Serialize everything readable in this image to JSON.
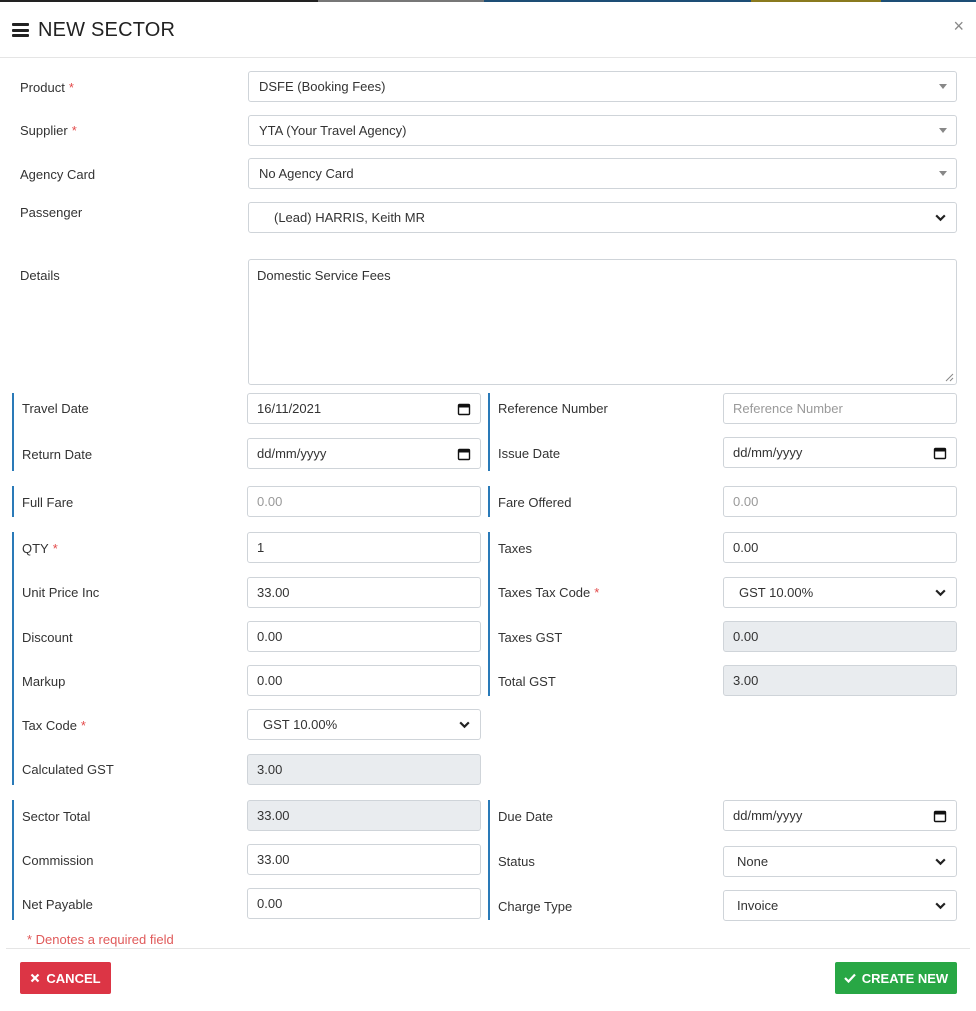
{
  "colors": {
    "accent_bar": "#2a7ab8",
    "danger": "#dc3545",
    "success": "#28a745",
    "required": "#e34a4a"
  },
  "header": {
    "title": "NEW SECTOR",
    "close_label": "×"
  },
  "required_marker": "*",
  "form": {
    "product": {
      "label": "Product",
      "value": "DSFE (Booking Fees)"
    },
    "supplier": {
      "label": "Supplier",
      "value": "YTA (Your Travel Agency)"
    },
    "agency_card": {
      "label": "Agency Card",
      "value": "No Agency Card"
    },
    "passenger": {
      "label": "Passenger",
      "value": "(Lead) HARRIS, Keith MR"
    },
    "details": {
      "label": "Details",
      "value": "Domestic Service Fees"
    },
    "travel_date": {
      "label": "Travel Date",
      "value": "16/11/2021"
    },
    "return_date": {
      "label": "Return Date",
      "value": "dd/mm/yyyy"
    },
    "reference_number": {
      "label": "Reference Number",
      "placeholder": "Reference Number"
    },
    "issue_date": {
      "label": "Issue Date",
      "value": "dd/mm/yyyy"
    },
    "full_fare": {
      "label": "Full Fare",
      "placeholder": "0.00"
    },
    "fare_offered": {
      "label": "Fare Offered",
      "placeholder": "0.00"
    },
    "qty": {
      "label": "QTY",
      "value": "1"
    },
    "taxes": {
      "label": "Taxes",
      "value": "0.00"
    },
    "unit_price_inc": {
      "label": "Unit Price Inc",
      "value": "33.00"
    },
    "taxes_tax_code": {
      "label": "Taxes Tax Code",
      "value": "GST 10.00%"
    },
    "discount": {
      "label": "Discount",
      "value": "0.00"
    },
    "taxes_gst": {
      "label": "Taxes GST",
      "value": "0.00"
    },
    "markup": {
      "label": "Markup",
      "value": "0.00"
    },
    "total_gst": {
      "label": "Total GST",
      "value": "3.00"
    },
    "tax_code": {
      "label": "Tax Code",
      "value": "GST 10.00%"
    },
    "calculated_gst": {
      "label": "Calculated GST",
      "value": "3.00"
    },
    "sector_total": {
      "label": "Sector Total",
      "value": "33.00"
    },
    "due_date": {
      "label": "Due Date",
      "value": "dd/mm/yyyy"
    },
    "commission": {
      "label": "Commission",
      "value": "33.00"
    },
    "status": {
      "label": "Status",
      "value": "None"
    },
    "net_payable": {
      "label": "Net Payable",
      "value": "0.00"
    },
    "charge_type": {
      "label": "Charge Type",
      "value": "Invoice"
    }
  },
  "footer": {
    "required_note": "* Denotes a required field",
    "cancel_label": "CANCEL",
    "create_label": "CREATE NEW"
  }
}
